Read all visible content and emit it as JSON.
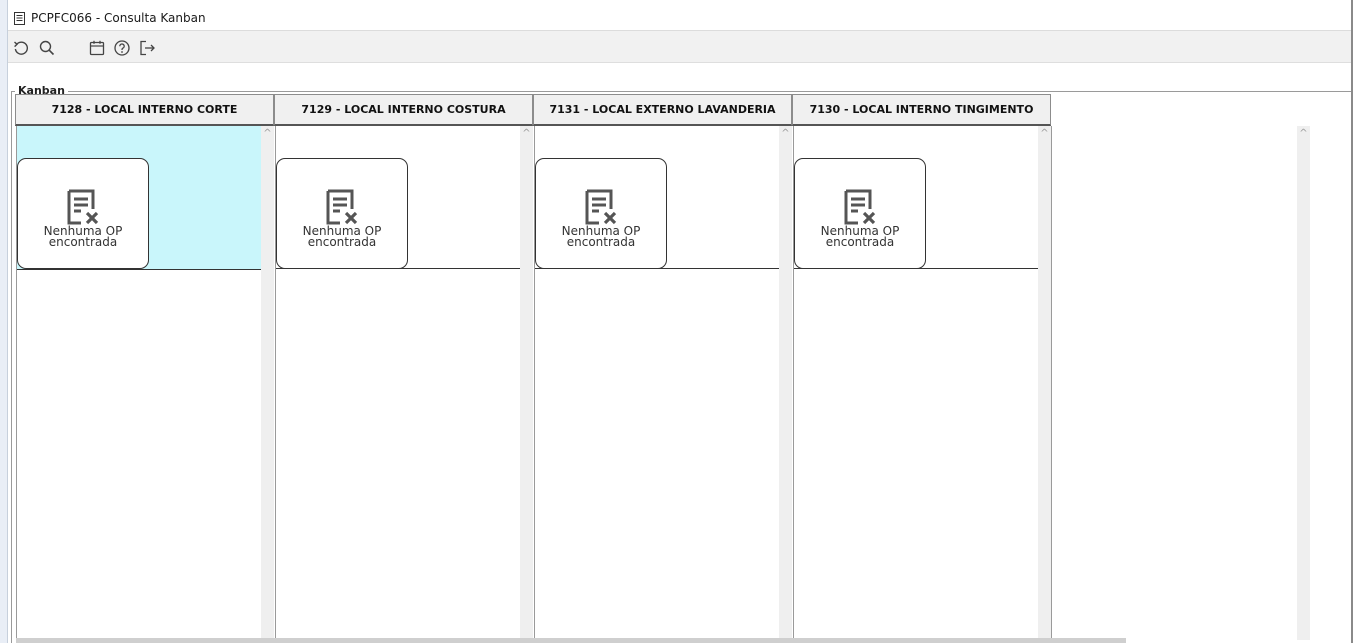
{
  "window": {
    "title": "PCPFC066 - Consulta Kanban",
    "icon": "document-icon"
  },
  "toolbar": {
    "tools": [
      {
        "name": "refresh-icon"
      },
      {
        "name": "search-icon"
      },
      {
        "name": "calendar-icon"
      },
      {
        "name": "help-icon"
      },
      {
        "name": "exit-icon"
      }
    ]
  },
  "kanban": {
    "group_label": "Kanban",
    "columns": [
      {
        "header": "7128 - LOCAL INTERNO CORTE",
        "empty_line1": "Nenhuma OP",
        "empty_line2": "encontrada",
        "selected": true
      },
      {
        "header": "7129 - LOCAL INTERNO COSTURA",
        "empty_line1": "Nenhuma OP",
        "empty_line2": "encontrada",
        "selected": false
      },
      {
        "header": "7131 - LOCAL EXTERNO LAVANDERIA",
        "empty_line1": "Nenhuma OP",
        "empty_line2": "encontrada",
        "selected": false
      },
      {
        "header": "7130 - LOCAL INTERNO TINGIMENTO",
        "empty_line1": "Nenhuma OP",
        "empty_line2": "encontrada",
        "selected": false
      }
    ],
    "empty_icon": "no-records-icon",
    "scroll_up_glyph": "^"
  },
  "colors": {
    "selected_column": "#c9f6fb",
    "header_bg": "#f0f0f0",
    "toolbar_bg": "#f1f1f1"
  }
}
